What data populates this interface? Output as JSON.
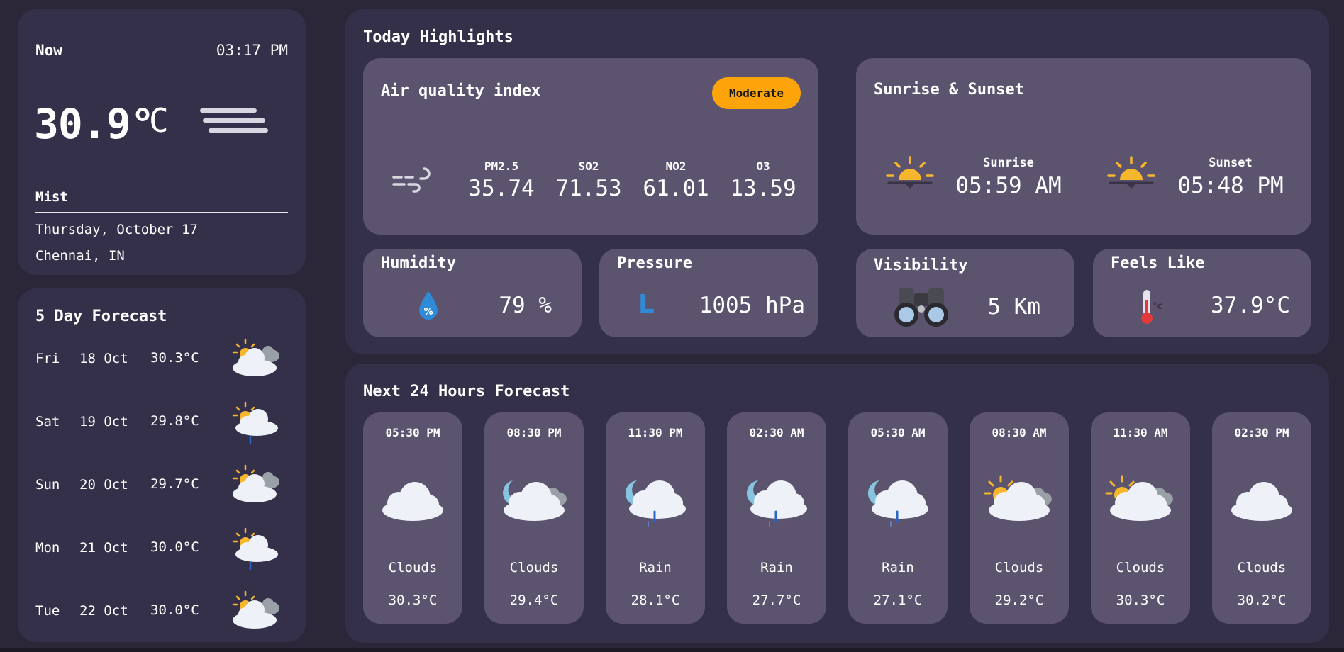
{
  "colors": {
    "background": "#2b2738",
    "panel": "#35304a",
    "card": "#5c546f",
    "badge": "#fca40a"
  },
  "now": {
    "label": "Now",
    "time": "03:17 PM",
    "temperature": "30.9°",
    "unit": "C",
    "icon": "mist-icon",
    "condition": "Mist",
    "date": "Thursday, October 17",
    "location": "Chennai, IN"
  },
  "forecast": {
    "title": "5 Day Forecast",
    "days": [
      {
        "day": "Fri",
        "date": "18 Oct",
        "temp": "30.3°C",
        "icon": "partly-cloudy-icon"
      },
      {
        "day": "Sat",
        "date": "19 Oct",
        "temp": "29.8°C",
        "icon": "sun-rain-icon"
      },
      {
        "day": "Sun",
        "date": "20 Oct",
        "temp": "29.7°C",
        "icon": "partly-cloudy-icon"
      },
      {
        "day": "Mon",
        "date": "21 Oct",
        "temp": "30.0°C",
        "icon": "sun-rain-icon"
      },
      {
        "day": "Tue",
        "date": "22 Oct",
        "temp": "30.0°C",
        "icon": "partly-cloudy-icon"
      }
    ]
  },
  "highlights": {
    "title": "Today Highlights",
    "aqi": {
      "title": "Air quality index",
      "badge": "Moderate",
      "icon": "wind-icon",
      "items": [
        {
          "label": "PM2.5",
          "value": "35.74"
        },
        {
          "label": "SO2",
          "value": "71.53"
        },
        {
          "label": "NO2",
          "value": "61.01"
        },
        {
          "label": "O3",
          "value": "13.59"
        }
      ]
    },
    "sun": {
      "title": "Sunrise & Sunset",
      "sunrise_label": "Sunrise",
      "sunrise": "05:59 AM",
      "sunset_label": "Sunset",
      "sunset": "05:48 PM"
    },
    "humidity": {
      "title": "Humidity",
      "value": "79 %",
      "icon": "humidity-drop-icon"
    },
    "pressure": {
      "title": "Pressure",
      "value": "1005 hPa",
      "icon": "pressure-icon",
      "glyph": "L"
    },
    "visibility": {
      "title": "Visibility",
      "value": "5 Km",
      "icon": "binoculars-icon"
    },
    "feels_like": {
      "title": "Feels Like",
      "value": "37.9°C",
      "icon": "thermometer-icon",
      "unit_glyph": "°c"
    }
  },
  "hourly": {
    "title": "Next 24 Hours Forecast",
    "items": [
      {
        "time": "05:30 PM",
        "condition": "Clouds",
        "temp": "30.3°C",
        "icon": "cloud-icon"
      },
      {
        "time": "08:30 PM",
        "condition": "Clouds",
        "temp": "29.4°C",
        "icon": "moon-clouds-icon"
      },
      {
        "time": "11:30 PM",
        "condition": "Rain",
        "temp": "28.1°C",
        "icon": "moon-rain-icon"
      },
      {
        "time": "02:30 AM",
        "condition": "Rain",
        "temp": "27.7°C",
        "icon": "moon-rain-icon"
      },
      {
        "time": "05:30 AM",
        "condition": "Rain",
        "temp": "27.1°C",
        "icon": "moon-rain-icon"
      },
      {
        "time": "08:30 AM",
        "condition": "Clouds",
        "temp": "29.2°C",
        "icon": "partly-cloudy-icon"
      },
      {
        "time": "11:30 AM",
        "condition": "Clouds",
        "temp": "30.3°C",
        "icon": "partly-cloudy-icon"
      },
      {
        "time": "02:30 PM",
        "condition": "Clouds",
        "temp": "30.2°C",
        "icon": "cloud-icon"
      }
    ]
  }
}
